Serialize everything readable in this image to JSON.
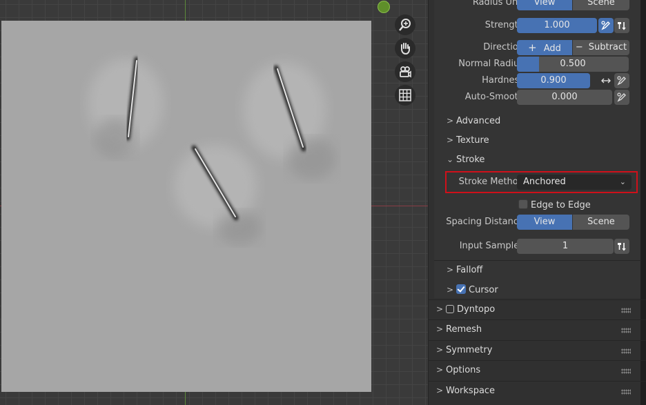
{
  "panel": {
    "radius_unit": {
      "label": "Radius Unit",
      "options": [
        "View",
        "Scene"
      ],
      "selected": "View"
    },
    "strength": {
      "label": "Strength",
      "value": "1.000"
    },
    "direction": {
      "label": "Direction",
      "options": [
        "Add",
        "Subtract"
      ],
      "selected": "Add"
    },
    "normal_radius": {
      "label": "Normal Radius",
      "value": "0.500",
      "fill_fraction": 0.2
    },
    "hardness": {
      "label": "Hardness",
      "value": "0.900"
    },
    "auto_smooth": {
      "label": "Auto-Smooth",
      "value": "0.000"
    },
    "sections": {
      "advanced": "Advanced",
      "texture": "Texture",
      "stroke": "Stroke",
      "falloff": "Falloff",
      "cursor": "Cursor",
      "dyntopo": "Dyntopo",
      "remesh": "Remesh",
      "symmetry": "Symmetry",
      "options": "Options",
      "workspace": "Workspace"
    },
    "stroke_method": {
      "label": "Stroke Method",
      "value": "Anchored"
    },
    "edge_to_edge": {
      "label": "Edge to Edge",
      "checked": false
    },
    "spacing_distance": {
      "label": "Spacing Distance",
      "options": [
        "View",
        "Scene"
      ],
      "selected": "View"
    },
    "input_samples": {
      "label": "Input Samples",
      "value": "1"
    },
    "cursor_checked": true,
    "dyntopo_checked": false
  },
  "viewport": {
    "nav_icons": [
      "zoom-icon",
      "pan-hand-icon",
      "camera-icon",
      "grid-icon"
    ]
  },
  "colors": {
    "accent_blue": "#4772b3",
    "field_gray": "#545454",
    "highlight_red": "#d0101a",
    "panel_bg": "#303030"
  }
}
